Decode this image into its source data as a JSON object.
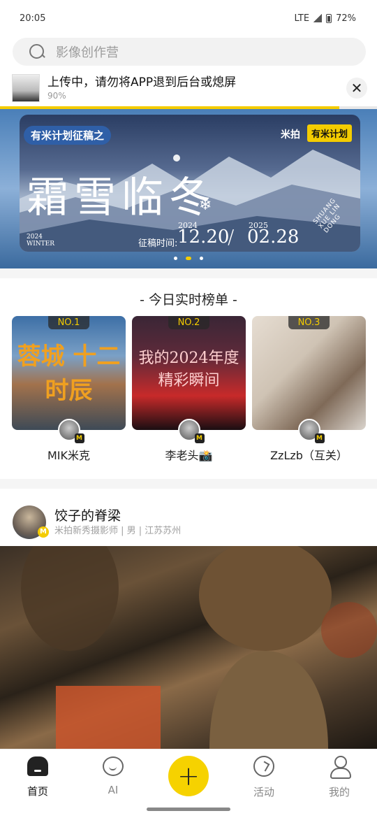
{
  "status_bar": {
    "time": "20:05",
    "network": "LTE",
    "battery": "72%"
  },
  "search": {
    "placeholder": "影像创作营"
  },
  "upload": {
    "title": "上传中，请勿将APP退到后台或熄屏",
    "percent_text": "90%",
    "progress": 0.9
  },
  "banner": {
    "tag": "有米计划征稿之",
    "logo_text": "米拍",
    "logo2_text": "有米计划",
    "title": "霜雪临冬",
    "winter_year": "2024",
    "winter_label": "WINTER",
    "date_label": "征稿时间:",
    "start_year": "2024",
    "end_year": "2025",
    "start_date": "12.20",
    "end_date": "02.28",
    "separator": "/",
    "arc_text": "SHUANG XUE LIN DONG",
    "dots": 3,
    "active_dot": 1
  },
  "ranking": {
    "title": "- 今日实时榜单 -",
    "items": [
      {
        "badge": "NO.1",
        "art": "蓉城 十二时辰",
        "name": "MIK米克",
        "m_badge": "M"
      },
      {
        "badge": "NO.2",
        "art": "我的2024年度 精彩瞬间",
        "name": "李老头📸",
        "m_badge": "M"
      },
      {
        "badge": "NO.3",
        "art": "",
        "name": "ZzLzb（互关）",
        "m_badge": "M"
      }
    ]
  },
  "post": {
    "author": "饺子的脊梁",
    "meta": "米拍新秀摄影师 | 男 | 江苏苏州",
    "badge": "M"
  },
  "tabbar": {
    "tabs": [
      {
        "label": "首页",
        "icon": "home-icon",
        "active": true
      },
      {
        "label": "AI",
        "icon": "ai-icon"
      },
      {
        "label": "",
        "icon": "plus-icon"
      },
      {
        "label": "活动",
        "icon": "activity-icon"
      },
      {
        "label": "我的",
        "icon": "me-icon"
      }
    ],
    "plus_glyph": "+"
  },
  "colors": {
    "accent": "#f4cc00",
    "text": "#222222",
    "muted": "#9c9c9c"
  }
}
